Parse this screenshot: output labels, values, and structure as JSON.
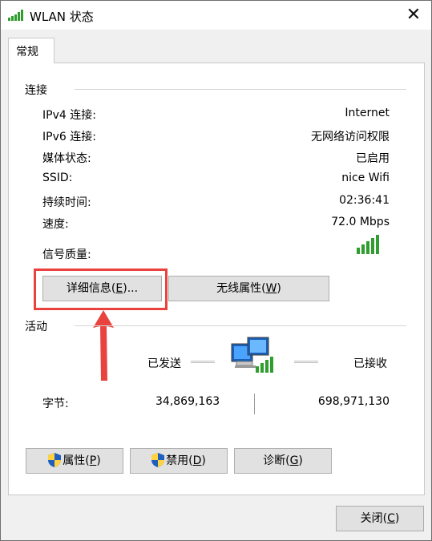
{
  "window": {
    "title": "WLAN 状态",
    "close_glyph": "✕"
  },
  "tabs": [
    {
      "label": "常规"
    }
  ],
  "connection": {
    "group_title": "连接",
    "rows": [
      {
        "label": "IPv4 连接:",
        "value": "Internet"
      },
      {
        "label": "IPv6 连接:",
        "value": "无网络访问权限"
      },
      {
        "label": "媒体状态:",
        "value": "已启用"
      },
      {
        "label": "SSID:",
        "value": "nice Wifi"
      },
      {
        "label": "持续时间:",
        "value": "02:36:41"
      },
      {
        "label": "速度:",
        "value": "72.0 Mbps"
      }
    ],
    "signal_label": "信号质量:",
    "signal_bars": 5,
    "details_button": {
      "text": "详细信息(",
      "key": "E",
      "suffix": ")..."
    },
    "wireless_button": {
      "text": "无线属性(",
      "key": "W",
      "suffix": ")"
    }
  },
  "activity": {
    "group_title": "活动",
    "sent_label": "已发送",
    "received_label": "已接收",
    "bytes_label": "字节:",
    "bytes_sent": "34,869,163",
    "bytes_received": "698,971,130"
  },
  "actions": {
    "properties": {
      "text": "属性(",
      "key": "P",
      "suffix": ")"
    },
    "disable": {
      "text": "禁用(",
      "key": "D",
      "suffix": ")"
    },
    "diagnose": {
      "text": "诊断(",
      "key": "G",
      "suffix": ")"
    }
  },
  "footer": {
    "close": {
      "text": "关闭(",
      "key": "C",
      "suffix": ")"
    }
  },
  "colors": {
    "accent_highlight": "#e8433e",
    "signal_green": "#2f9e2f"
  },
  "icons": [
    "wifi-signal-icon",
    "close-icon",
    "network-computers-icon",
    "uac-shield-icon",
    "annotation-arrow"
  ]
}
